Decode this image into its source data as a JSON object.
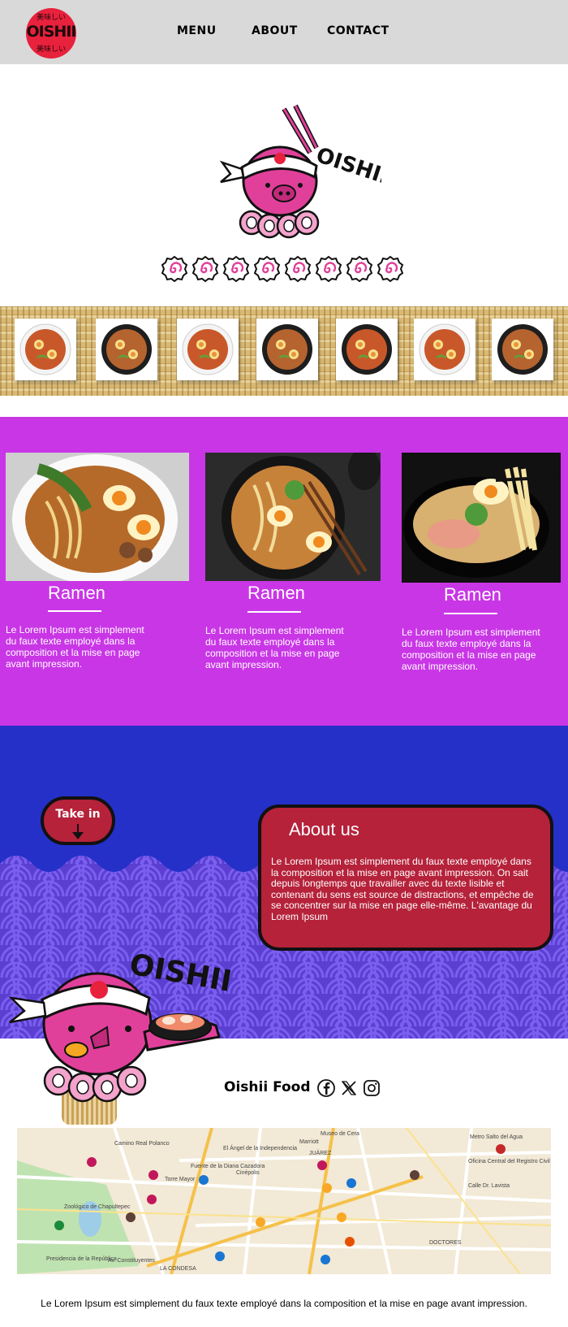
{
  "nav": {
    "logo_text": "OISHII",
    "logo_kana_top": "美味しい",
    "logo_kana_bottom": "美味しい",
    "links": [
      "MENU",
      "ABOUT",
      "CONTACT"
    ]
  },
  "hero": {
    "mascot_word": "OISHII",
    "naruto_count": 8
  },
  "bamboo_strip": {
    "bowls": 7
  },
  "cards": [
    {
      "title": "Ramen",
      "text": "Le Lorem Ipsum est simplement du faux texte employé dans la composition et la mise en page avant impression."
    },
    {
      "title": "Ramen",
      "text": "Le Lorem Ipsum est simplement du faux texte employé dans la composition et la mise en page avant impression."
    },
    {
      "title": "Ramen",
      "text": "Le Lorem Ipsum est simplement du faux texte employé dans la composition et la mise en page avant impression."
    }
  ],
  "take_in": {
    "label": "Take in"
  },
  "about": {
    "title": "About us",
    "text": "Le Lorem Ipsum est simplement du faux texte employé dans la composition et la mise en page avant impression.  On sait depuis longtemps que travailler avec du texte lisible et contenant du sens est source de distractions, et empêche de se concentrer sur la mise en page elle-même. L'avantage du Lorem Ipsum"
  },
  "footer": {
    "brand": "Oishii Food",
    "social_icons": [
      "facebook-icon",
      "x-icon",
      "instagram-icon"
    ],
    "text": "Le Lorem Ipsum est simplement du faux texte employé dans la composition et la mise en page avant impression."
  },
  "map": {
    "labels": [
      "Museo de Cera",
      "Marriott",
      "Metro Salto del Agua",
      "JUÁREZ",
      "El Ángel de la Independencia",
      "Fuente de la Diana Cazadora",
      "Zoológico de Chapultepec",
      "Camino Real Polanco",
      "Torre Mayor",
      "Cinépolis",
      "Oficina Central del Registro Civil",
      "DOCTORES",
      "Presidencia de la República",
      "LA CONDESA",
      "Av. Constituyentes",
      "Calle Dr. Lavista"
    ]
  },
  "colors": {
    "nav_bg": "#d9d9d9",
    "accent_red": "#e8213d",
    "purple": "#c936e6",
    "blue": "#2530c9",
    "wave": "#6b4fe0",
    "box_red": "#b5223a",
    "mascot_pink": "#e0409a"
  }
}
